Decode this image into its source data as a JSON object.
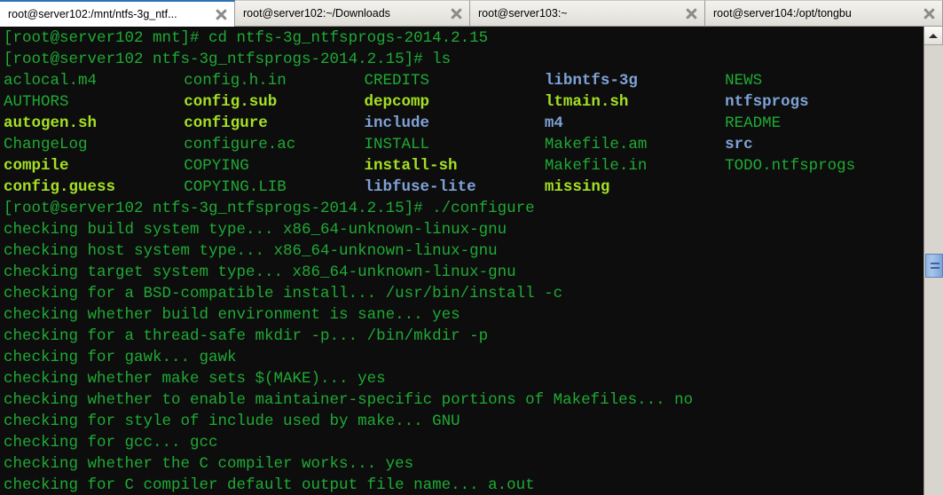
{
  "window": {
    "accent_color": "#2f6fb5",
    "terminal_bg": "#0d0d0d",
    "fg_green": "#1faa34",
    "fg_exec": "#a4e024",
    "fg_dir": "#7fa2d6"
  },
  "tabs": [
    {
      "label": "root@server102:/mnt/ntfs-3g_ntf...",
      "active": true,
      "close_icon": "close-icon"
    },
    {
      "label": "root@server102:~/Downloads",
      "active": false,
      "close_icon": "close-icon"
    },
    {
      "label": "root@server103:~",
      "active": false,
      "close_icon": "close-icon"
    },
    {
      "label": "root@server104:/opt/tongbu",
      "active": false,
      "close_icon": "close-icon"
    }
  ],
  "scrollbar": {
    "up_icon": "chevron-up-icon",
    "thumb_position_percent": 49
  },
  "terminal": {
    "prompt_1": "[root@server102 mnt]# cd ntfs-3g_ntfsprogs-2014.2.15",
    "prompt_2": "[root@server102 ntfs-3g_ntfsprogs-2014.2.15]# ls",
    "prompt_3": "[root@server102 ntfs-3g_ntfsprogs-2014.2.15]# ./configure",
    "ls_columns": [
      [
        {
          "name": "aclocal.m4",
          "kind": "file"
        },
        {
          "name": "AUTHORS",
          "kind": "file"
        },
        {
          "name": "autogen.sh",
          "kind": "exec"
        },
        {
          "name": "ChangeLog",
          "kind": "file"
        },
        {
          "name": "compile",
          "kind": "exec"
        },
        {
          "name": "config.guess",
          "kind": "exec"
        }
      ],
      [
        {
          "name": "config.h.in",
          "kind": "file"
        },
        {
          "name": "config.sub",
          "kind": "exec"
        },
        {
          "name": "configure",
          "kind": "exec"
        },
        {
          "name": "configure.ac",
          "kind": "file"
        },
        {
          "name": "COPYING",
          "kind": "file"
        },
        {
          "name": "COPYING.LIB",
          "kind": "file"
        }
      ],
      [
        {
          "name": "CREDITS",
          "kind": "file"
        },
        {
          "name": "depcomp",
          "kind": "exec"
        },
        {
          "name": "include",
          "kind": "dir"
        },
        {
          "name": "INSTALL",
          "kind": "file"
        },
        {
          "name": "install-sh",
          "kind": "exec"
        },
        {
          "name": "libfuse-lite",
          "kind": "dir"
        }
      ],
      [
        {
          "name": "libntfs-3g",
          "kind": "dir"
        },
        {
          "name": "ltmain.sh",
          "kind": "exec"
        },
        {
          "name": "m4",
          "kind": "dir"
        },
        {
          "name": "Makefile.am",
          "kind": "file"
        },
        {
          "name": "Makefile.in",
          "kind": "file"
        },
        {
          "name": "missing",
          "kind": "exec"
        }
      ],
      [
        {
          "name": "NEWS",
          "kind": "file"
        },
        {
          "name": "ntfsprogs",
          "kind": "dir"
        },
        {
          "name": "README",
          "kind": "file"
        },
        {
          "name": "src",
          "kind": "dir"
        },
        {
          "name": "TODO.ntfsprogs",
          "kind": "file"
        },
        {
          "name": "",
          "kind": "file"
        }
      ]
    ],
    "configure_output": [
      "checking build system type... x86_64-unknown-linux-gnu",
      "checking host system type... x86_64-unknown-linux-gnu",
      "checking target system type... x86_64-unknown-linux-gnu",
      "checking for a BSD-compatible install... /usr/bin/install -c",
      "checking whether build environment is sane... yes",
      "checking for a thread-safe mkdir -p... /bin/mkdir -p",
      "checking for gawk... gawk",
      "checking whether make sets $(MAKE)... yes",
      "checking whether to enable maintainer-specific portions of Makefiles... no",
      "checking for style of include used by make... GNU",
      "checking for gcc... gcc",
      "checking whether the C compiler works... yes",
      "checking for C compiler default output file name... a.out"
    ]
  }
}
